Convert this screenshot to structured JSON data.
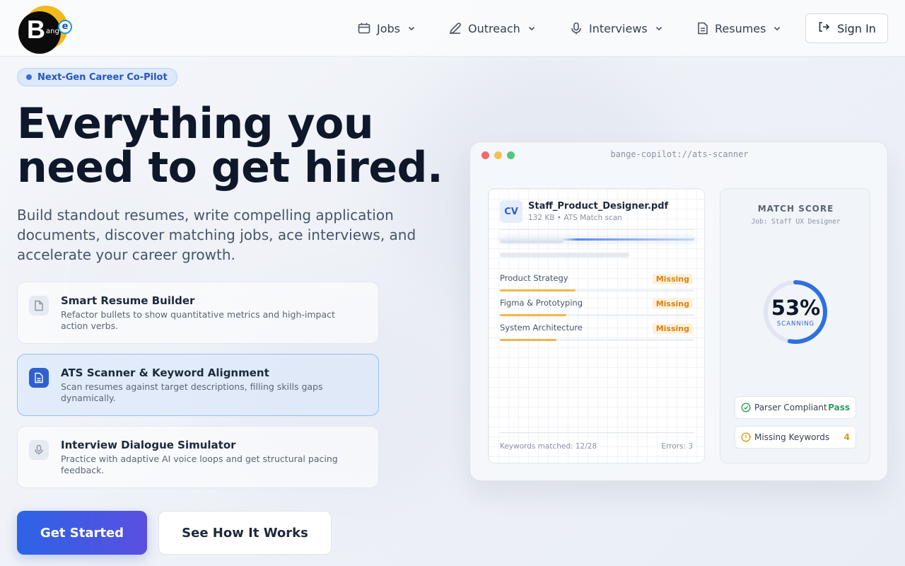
{
  "brand": {
    "logo_letter": "B",
    "logo_small": "ang",
    "logo_badge": "e"
  },
  "nav": {
    "items": [
      {
        "label": "Jobs",
        "icon": "calendar-icon"
      },
      {
        "label": "Outreach",
        "icon": "pencil-icon"
      },
      {
        "label": "Interviews",
        "icon": "microphone-icon"
      },
      {
        "label": "Resumes",
        "icon": "document-icon"
      }
    ],
    "signin_label": "Sign In"
  },
  "hero": {
    "pill": "Next-Gen Career Co-Pilot",
    "title": "Everything you need to get hired.",
    "subtitle": "Build standout resumes, write compelling application documents, discover matching jobs, ace interviews, and accelerate your career growth."
  },
  "features": [
    {
      "title": "Smart Resume Builder",
      "desc": "Refactor bullets to show quantitative metrics and high-impact action verbs.",
      "active": false
    },
    {
      "title": "ATS Scanner & Keyword Alignment",
      "desc": "Scan resumes against target descriptions, filling skills gaps dynamically.",
      "active": true
    },
    {
      "title": "Interview Dialogue Simulator",
      "desc": "Practice with adaptive AI voice loops and get structural pacing feedback.",
      "active": false
    }
  ],
  "cta": {
    "primary": "Get Started",
    "secondary": "See How It Works"
  },
  "mockup": {
    "url": "bange-copilot://ats-scanner",
    "doc": {
      "badge": "CV",
      "name": "Staff_Product_Designer.pdf",
      "meta": "132 KB • ATS Match scan",
      "keywords": [
        {
          "name": "Product Strategy",
          "status": "Missing",
          "level": 0.39
        },
        {
          "name": "Figma & Prototyping",
          "status": "Missing",
          "level": 0.34
        },
        {
          "name": "System Architecture",
          "status": "Missing",
          "level": 0.29
        }
      ],
      "footer_left": "Keywords matched: 12/28",
      "footer_right": "Errors: 3"
    },
    "score": {
      "title": "MATCH SCORE",
      "job": "Job: Staff UX Designer",
      "value": "53%",
      "percent": 53,
      "status": "SCANNING",
      "stats": [
        {
          "label": "Parser Compliant",
          "value": "Pass"
        },
        {
          "label": "Missing Keywords",
          "value": "4"
        }
      ]
    }
  },
  "colors": {
    "accent": "#2f5fd0",
    "pass": "#2f9e5b",
    "warn": "#d9830e",
    "logo_ring": "#f3b81c"
  }
}
